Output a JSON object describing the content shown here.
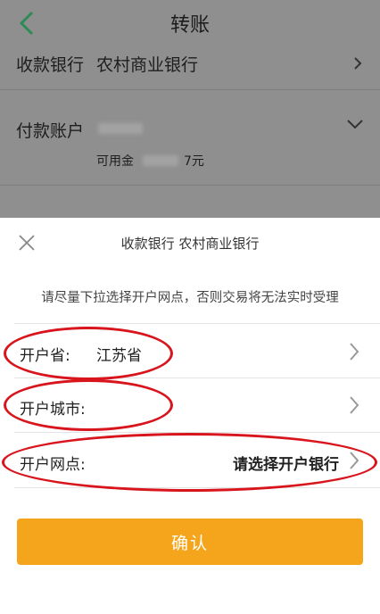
{
  "header": {
    "title": "转账"
  },
  "background": {
    "payee_bank": {
      "label": "收款银行",
      "value": "农村商业银行"
    },
    "payer_account": {
      "label": "付款账户",
      "balance_prefix": "可用金",
      "balance_suffix": "7元"
    }
  },
  "sheet": {
    "title": "收款银行  农村商业银行",
    "hint": "请尽量下拉选择开户网点，否则交易将无法实时受理",
    "province": {
      "label": "开户省:",
      "value": "江苏省"
    },
    "city": {
      "label": "开户城市:",
      "value": ""
    },
    "branch": {
      "label": "开户网点:",
      "value": "请选择开户银行"
    },
    "confirm_label": "确认"
  },
  "colors": {
    "annotation_ring": "#d8141c",
    "confirm": "#f4a51c",
    "back_arrow": "#2e8b57"
  }
}
